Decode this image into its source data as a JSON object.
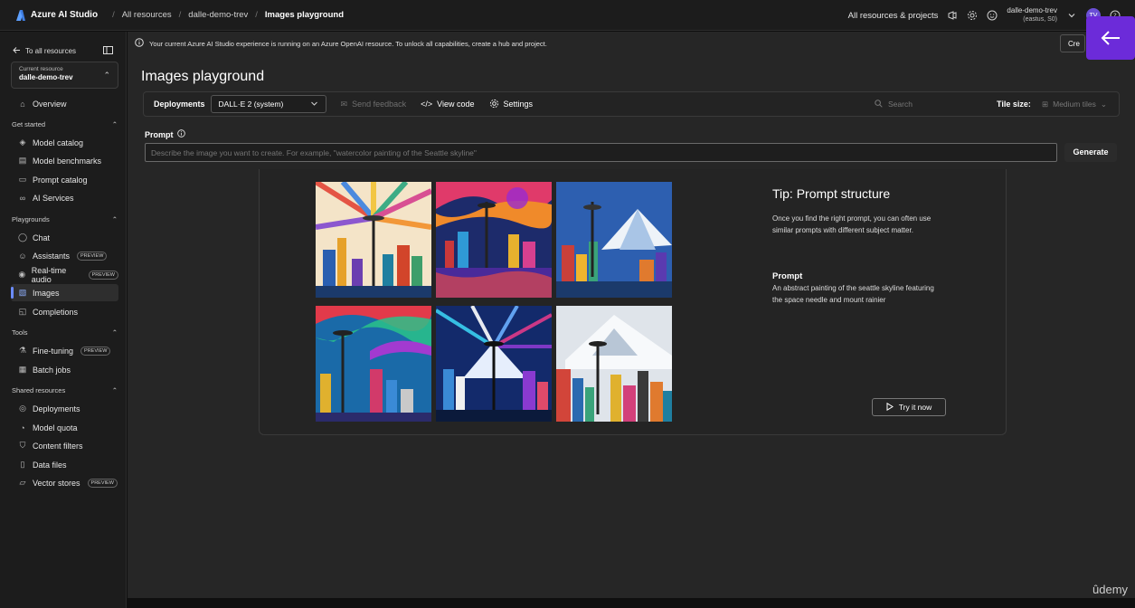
{
  "topbar": {
    "app_name": "Azure AI Studio",
    "breadcrumbs": [
      "All resources",
      "dalle-demo-trev",
      "Images playground"
    ],
    "projects_link": "All resources & projects",
    "account_name": "dalle-demo-trev",
    "account_sub": "(eastus, S0)",
    "avatar_initials": "TV"
  },
  "sidebar": {
    "back_label": "To all resources",
    "resource_caption": "Current resource",
    "resource_name": "dalle-demo-trev",
    "overview": "Overview",
    "groups": {
      "get_started": "Get started",
      "playgrounds": "Playgrounds",
      "tools": "Tools",
      "shared": "Shared resources"
    },
    "items": {
      "model_catalog": "Model catalog",
      "model_benchmarks": "Model benchmarks",
      "prompt_catalog": "Prompt catalog",
      "ai_services": "AI Services",
      "chat": "Chat",
      "assistants": "Assistants",
      "realtime_audio": "Real-time audio",
      "images": "Images",
      "completions": "Completions",
      "fine_tuning": "Fine-tuning",
      "batch_jobs": "Batch jobs",
      "deployments": "Deployments",
      "model_quota": "Model quota",
      "content_filters": "Content filters",
      "data_files": "Data files",
      "vector_stores": "Vector stores"
    },
    "preview_badge": "PREVIEW"
  },
  "banner": {
    "text": "Your current Azure AI Studio experience is running on an Azure OpenAI resource. To unlock all capabilities, create a hub and project.",
    "create_label": "Cre"
  },
  "main": {
    "title": "Images playground",
    "toolbar": {
      "deployments_label": "Deployments",
      "deployment_value": "DALL·E 2 (system)",
      "send_feedback": "Send feedback",
      "view_code": "View code",
      "settings": "Settings",
      "search_placeholder": "Search",
      "tile_size_label": "Tile size:",
      "tile_size_value": "Medium tiles"
    },
    "prompt_label": "Prompt",
    "prompt_placeholder": "Describe the image you want to create. For example, \"watercolor painting of the Seattle skyline\"",
    "generate": "Generate",
    "tip": {
      "title": "Tip: Prompt structure",
      "body": "Once you find the right prompt, you can often use similar prompts with different subject matter.",
      "prompt_heading": "Prompt",
      "prompt_text": "An abstract painting of the seattle skyline featuring the space needle and mount rainier",
      "try_button": "Try it now"
    }
  },
  "watermark": "ûdemy",
  "colors": {
    "accent": "#6c2bd9",
    "active_indicator": "#6b8cff",
    "background": "#262626"
  }
}
